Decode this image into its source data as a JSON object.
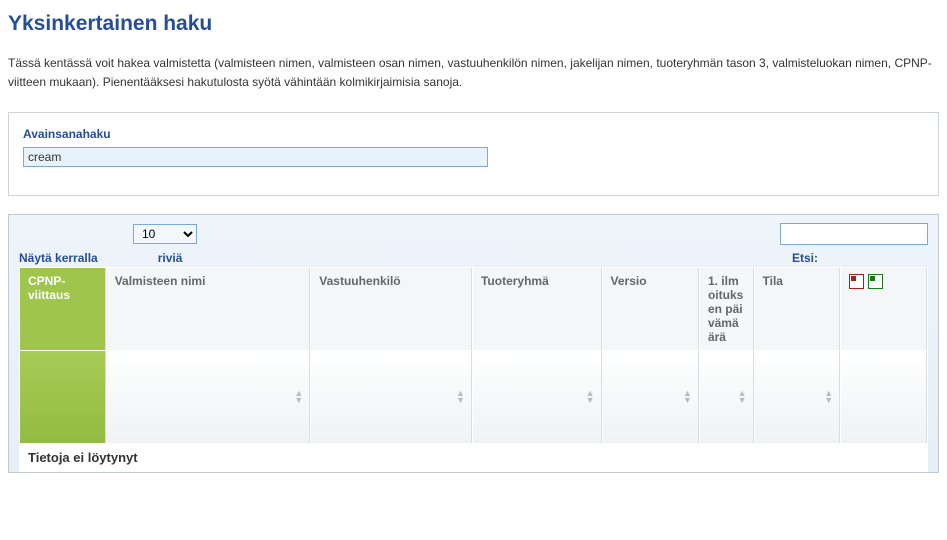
{
  "page": {
    "title": "Yksinkertainen haku",
    "description": "Tässä kentässä voit hakea valmistetta (valmisteen nimen, valmisteen osan nimen, vastuuhenkilön nimen, jakelijan nimen, tuoteryhmän tason 3, valmisteluokan nimen, CPNP-viitteen mukaan). Pienentääksesi hakutulosta syötä vähintään kolmikirjaimisia sanoja."
  },
  "search": {
    "label": "Avainsanahaku",
    "value": "cream"
  },
  "pager": {
    "show_prefix": "Näytä kerralla",
    "show_suffix": "riviä",
    "selected": "10",
    "filter_label": "Etsi:",
    "filter_value": ""
  },
  "columns": {
    "cpnp": "CPNP-viittaus",
    "name": "Valmisteen nimi",
    "responsible": "Vastuuhenkilö",
    "group": "Tuoteryhmä",
    "version": "Versio",
    "first_date": "1. ilmoituksen päivämäärä",
    "status": "Tila"
  },
  "table": {
    "empty": "Tietoja ei löytynyt"
  },
  "icons": {
    "pdf": "pdf-export-icon",
    "xls": "excel-export-icon"
  }
}
